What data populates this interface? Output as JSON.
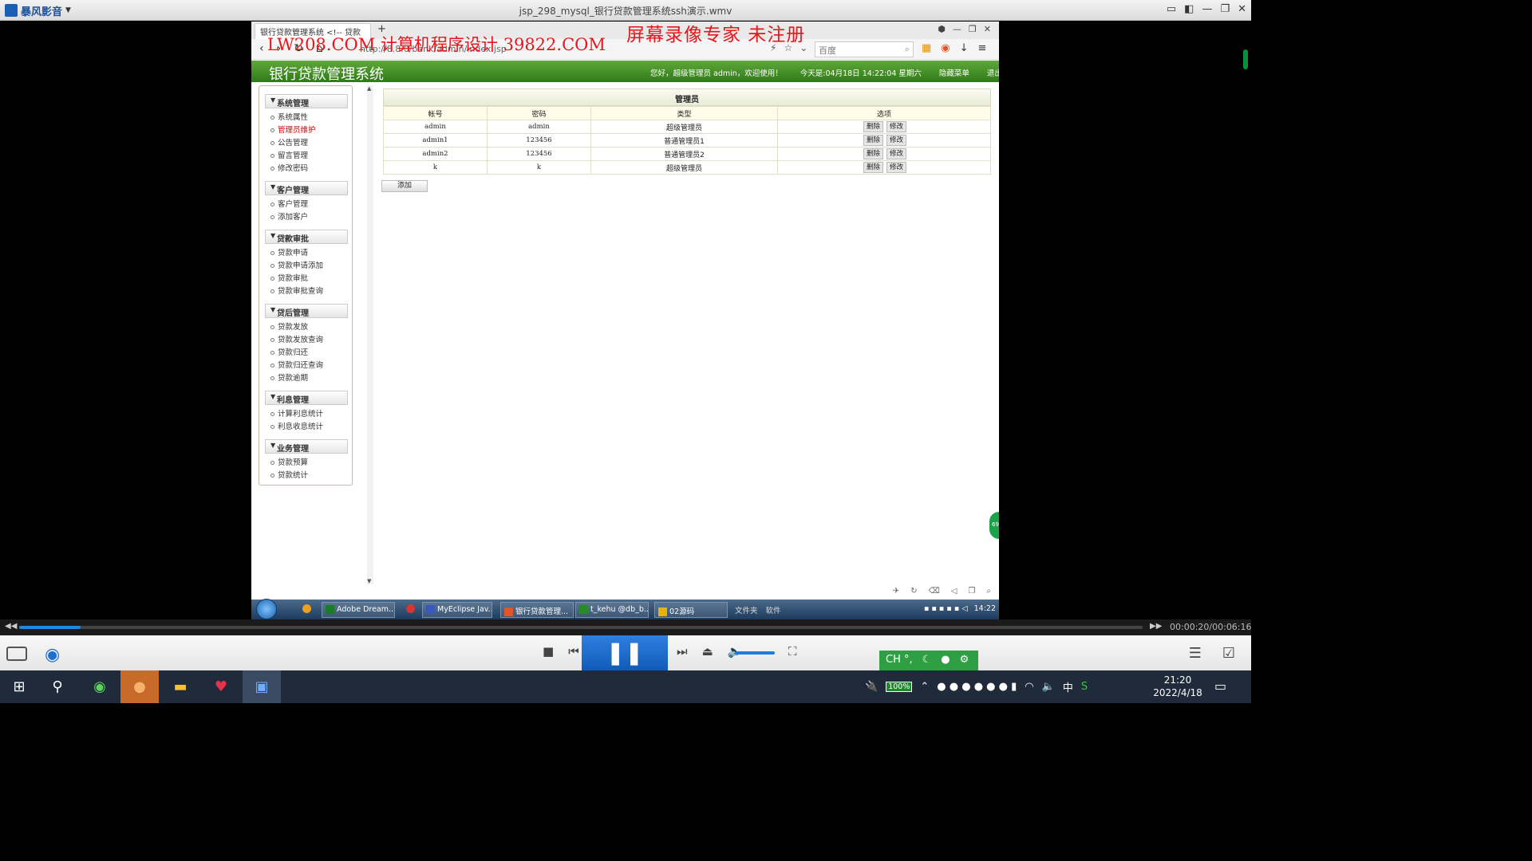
{
  "player": {
    "app_name": "暴风影音",
    "title": "jsp_298_mysql_银行贷款管理系统ssh演示.wmv",
    "time": "00:00:20/00:06:16",
    "progress_fraction": 0.055
  },
  "browser": {
    "tab_title": "银行贷款管理系统 <!-- 贷款",
    "url": "http://8.8.0/bank/admin/index.jsp",
    "search_placeholder": "百度"
  },
  "watermarks": {
    "left": "LW208.COM 计算机程序设计 39822.COM",
    "right": "屏幕录像专家 未注册"
  },
  "app": {
    "title": "银行贷款管理系统",
    "greeting": "您好，超级管理员 admin，欢迎使用！",
    "date": "今天是:04月18日  14:22:04  星期六",
    "hide_menu": "隐藏菜单",
    "logout": "退出"
  },
  "sidebar": [
    {
      "group": "系统管理",
      "items": [
        "系统属性",
        "管理员维护",
        "公告管理",
        "留言管理",
        "修改密码"
      ]
    },
    {
      "group": "客户管理",
      "items": [
        "客户管理",
        "添加客户"
      ]
    },
    {
      "group": "贷款审批",
      "items": [
        "贷款申请",
        "贷款申请添加",
        "贷款审批",
        "贷款审批查询"
      ]
    },
    {
      "group": "贷后管理",
      "items": [
        "贷款发放",
        "贷款发放查询",
        "贷款归还",
        "贷款归还查询",
        "贷款逾期"
      ]
    },
    {
      "group": "利息管理",
      "items": [
        "计算利息统计",
        "利息收息统计"
      ]
    },
    {
      "group": "业务管理",
      "items": [
        "贷款预算",
        "贷款统计"
      ]
    }
  ],
  "table": {
    "title": "管理员",
    "headers": [
      "帐号",
      "密码",
      "类型",
      "选项"
    ],
    "rows": [
      {
        "account": "admin",
        "password": "admin",
        "type": "超级管理员"
      },
      {
        "account": "admin1",
        "password": "123456",
        "type": "普通管理员1"
      },
      {
        "account": "admin2",
        "password": "123456",
        "type": "普通管理员2"
      },
      {
        "account": "k",
        "password": "k",
        "type": "超级管理员"
      }
    ],
    "delete_label": "删除",
    "edit_label": "修改",
    "add_label": "添加"
  },
  "win7_taskbar": {
    "tasks": [
      "Adobe Dream...",
      "MyEclipse Jav...",
      "银行贷款管理...",
      "t_kehu @db_b...",
      "02源码"
    ],
    "mid": [
      "文件夹",
      "软件"
    ],
    "time": "14:22"
  },
  "ime": "CH °,",
  "win10": {
    "battery": "100%",
    "lang": "中",
    "time": "21:20",
    "date": "2022/4/18"
  }
}
